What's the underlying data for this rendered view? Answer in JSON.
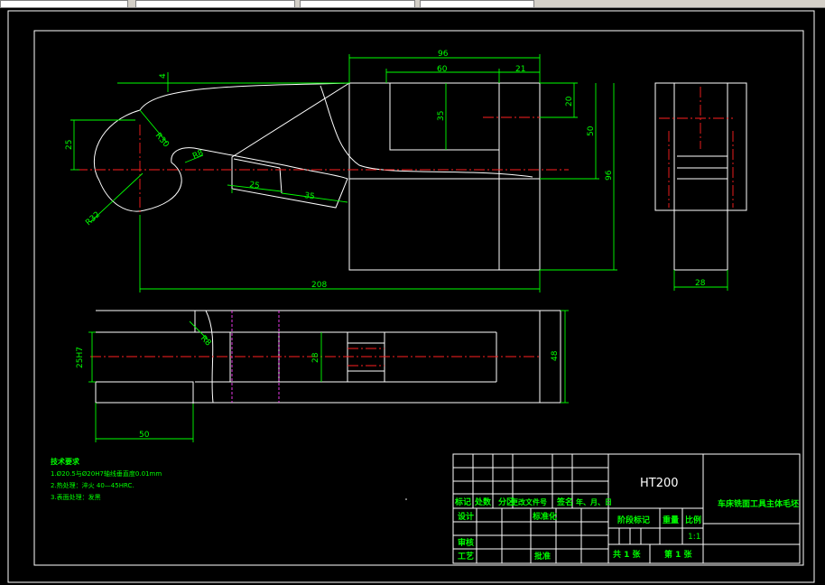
{
  "dimensions": {
    "d96_top": "96",
    "d60": "60",
    "d21": "21",
    "d20": "20",
    "d35_inner": "35",
    "d50_right": "50",
    "d96_right": "96",
    "d25": "25",
    "d4": "4",
    "r30": "R30",
    "r8": "R8",
    "r32": "R32",
    "d25_slot": "25",
    "d35_slot": "35",
    "d208": "208",
    "d28_side": "28",
    "d28_bottom": "28",
    "d48": "48",
    "d25h7": "25H7",
    "r8_bottom": "R8",
    "d50_bottom": "50"
  },
  "notes": {
    "title": "技术要求",
    "line1": "1.Ø20.5与Ø20H7轴线垂直度0.01mm",
    "line2": "2.热处理：淬火 40—45HRC.",
    "line3": "3.表面处理：发黑"
  },
  "title_block": {
    "material": "HT200",
    "part_name": "车床铣面工具主体毛坯",
    "h_mark": "标记",
    "h_count": "处数",
    "h_zone": "分区",
    "h_docno": "更改文件号",
    "h_sign": "签名",
    "h_date": "年、月、日",
    "design": "设计",
    "standard": "标准化",
    "stage_mark": "阶段标记",
    "weight": "重量",
    "scale_label": "比例",
    "scale_value": "1:1",
    "review": "审核",
    "process": "工艺",
    "approve": "批准",
    "total_sheets": "共 1 张",
    "sheet_no": "第 1 张"
  }
}
